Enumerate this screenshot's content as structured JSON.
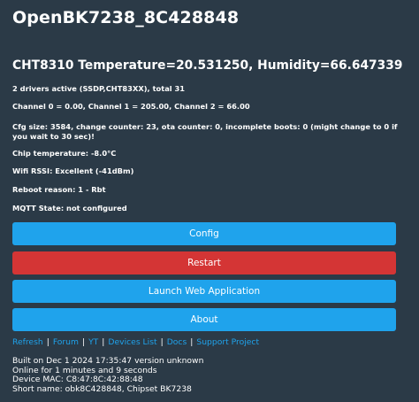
{
  "page": {
    "title": "OpenBK7238_8C428848",
    "sensor_line": "CHT8310 Temperature=20.531250, Humidity=66.647339"
  },
  "info": {
    "drivers": "2 drivers active (SSDP,CHT83XX), total 31",
    "channels": "Channel 0 = 0.00, Channel 1 = 205.00, Channel 2 = 66.00",
    "cfg": "Cfg size: 3584, change counter: 23, ota counter: 0, incomplete boots: 0 (might change to 0 if you wait to 30 sec)!",
    "chip_temp": "Chip temperature: -8.0°C",
    "wifi": "Wifi RSSI: Excellent (-41dBm)",
    "reboot": "Reboot reason: 1 - Rbt",
    "mqtt": "MQTT State: not configured"
  },
  "buttons": {
    "config": "Config",
    "restart": "Restart",
    "launch": "Launch Web Application",
    "about": "About"
  },
  "links": {
    "refresh": "Refresh",
    "forum": "Forum",
    "yt": "YT",
    "devices": "Devices List",
    "docs": "Docs",
    "support": "Support Project",
    "separator": "|"
  },
  "footer": {
    "built": "Built on Dec 1 2024 17:35:47 version unknown",
    "online": "Online for 1 minutes and 9 seconds",
    "mac": "Device MAC: C8:47:8C:42:88:48",
    "short": "Short name: obk8C428848, Chipset BK7238"
  },
  "colors": {
    "background": "#2b3a47",
    "primary_button": "#1fa3ec",
    "danger_button": "#d43535",
    "link": "#1fa3ec"
  }
}
